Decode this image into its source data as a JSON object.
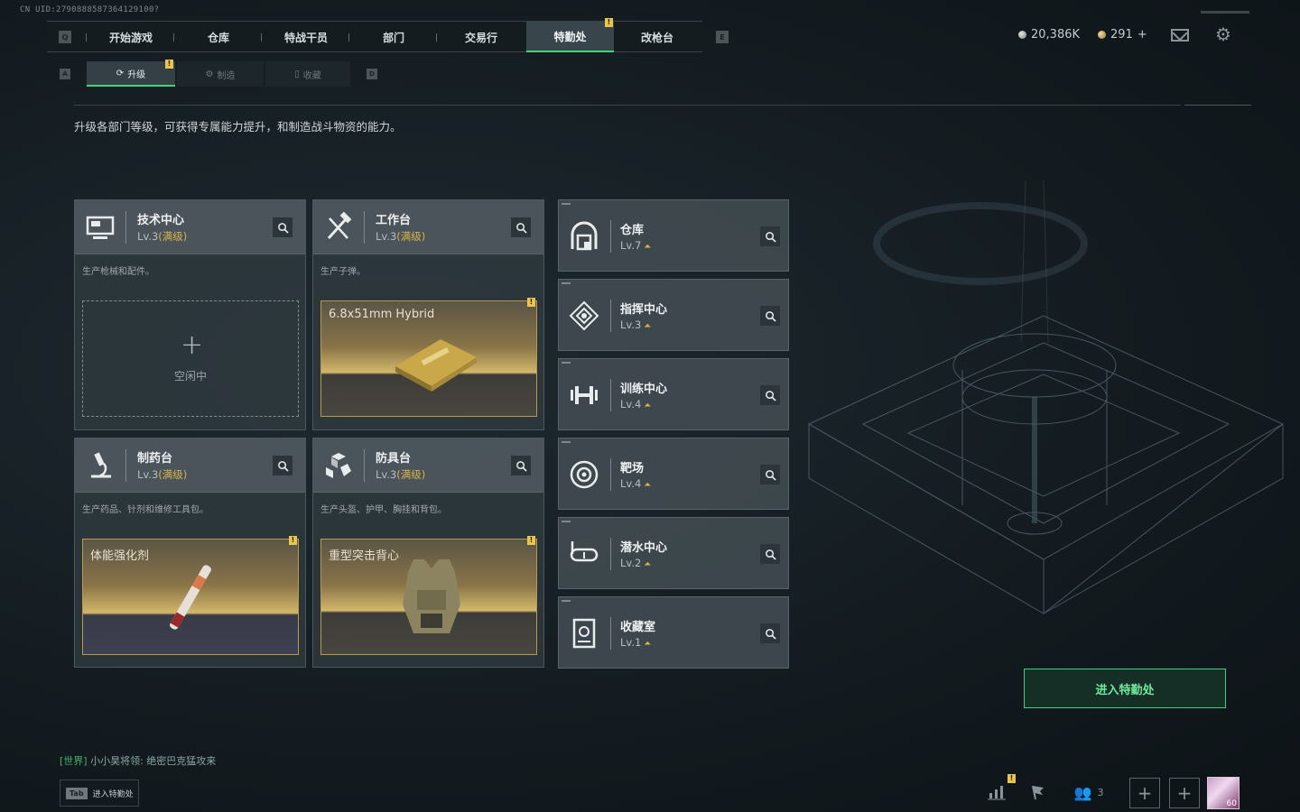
{
  "uid": "CN UID:2790888587364129100?",
  "nav": {
    "q_key": "Q",
    "e_key": "E",
    "tabs": [
      "开始游戏",
      "仓库",
      "特战干员",
      "部门",
      "交易行",
      "特勤处",
      "改枪台"
    ],
    "active": "特勤处",
    "badge": "!"
  },
  "currency": {
    "coins": "20,386K",
    "tickets": "291",
    "tickets_plus": "+"
  },
  "subtabs": {
    "a_key": "A",
    "d_key": "D",
    "items": [
      "升级",
      "制造",
      "收藏"
    ],
    "active": "升级",
    "badge": "!"
  },
  "description": "升级各部门等级，可获得专属能力提升，和制造战斗物资的能力。",
  "cards": [
    {
      "name": "技术中心",
      "lv": "Lv.3",
      "max": "(满级)",
      "desc": "生产枪械和配件。",
      "slot_type": "empty",
      "idle": "空闲中",
      "plus": "+"
    },
    {
      "name": "工作台",
      "lv": "Lv.3",
      "max": "(满级)",
      "desc": "生产子弹。",
      "slot_type": "product",
      "product": "6.8x51mm Hybrid",
      "badge": "!"
    },
    {
      "name": "制药台",
      "lv": "Lv.3",
      "max": "(满级)",
      "desc": "生产药品、针剂和维修工具包。",
      "slot_type": "product",
      "product": "体能强化剂",
      "badge": "!"
    },
    {
      "name": "防具台",
      "lv": "Lv.3",
      "max": "(满级)",
      "desc": "生产头盔、护甲、胸挂和背包。",
      "slot_type": "product",
      "product": "重型突击背心",
      "badge": "!"
    }
  ],
  "departments": [
    {
      "name": "仓库",
      "lv": "Lv.7",
      "icon": "warehouse-icon"
    },
    {
      "name": "指挥中心",
      "lv": "Lv.3",
      "icon": "command-icon"
    },
    {
      "name": "训练中心",
      "lv": "Lv.4",
      "icon": "dumbbell-icon"
    },
    {
      "name": "靶场",
      "lv": "Lv.4",
      "icon": "target-icon"
    },
    {
      "name": "潜水中心",
      "lv": "Lv.2",
      "icon": "diving-mask-icon"
    },
    {
      "name": "收藏室",
      "lv": "Lv.1",
      "icon": "collection-icon"
    }
  ],
  "enter_button": "进入特勤处",
  "chat": {
    "channel": "[世界]",
    "message": "小小昊将领: 绝密巴克猛攻来"
  },
  "tab_button": {
    "key": "Tab",
    "label": "进入特勤处"
  },
  "bottom": {
    "friends": "3",
    "level": "60",
    "stats_badge": "!"
  },
  "colors": {
    "accent_green": "#3ed67a",
    "gold": "#d8b34a",
    "badge_yellow": "#e9c54b"
  }
}
